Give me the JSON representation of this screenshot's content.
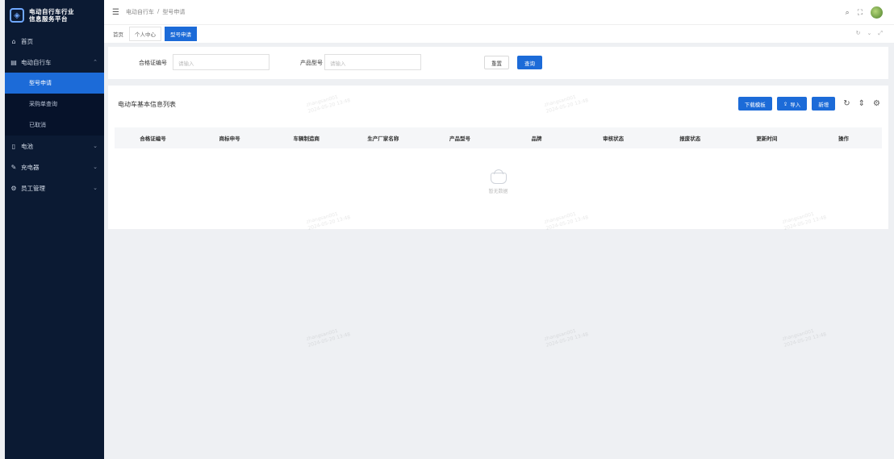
{
  "brand": {
    "title_line1": "电动自行车行业",
    "title_line2": "信息服务平台"
  },
  "sidebar": {
    "items": [
      {
        "label": "首页",
        "icon": "home-icon"
      },
      {
        "label": "电动自行车",
        "icon": "bike-icon",
        "expanded": true
      },
      {
        "label": "电池",
        "icon": "battery-icon"
      },
      {
        "label": "充电器",
        "icon": "charger-icon"
      },
      {
        "label": "员工管理",
        "icon": "staff-icon"
      }
    ],
    "submenu": [
      {
        "label": "型号申请",
        "active": true
      },
      {
        "label": "采购单查询",
        "active": false
      },
      {
        "label": "已取消",
        "active": false
      }
    ]
  },
  "header": {
    "breadcrumb": [
      "电动自行车",
      "型号申请"
    ]
  },
  "tabs": [
    {
      "label": "首页",
      "active": false
    },
    {
      "label": "个人中心",
      "active": false
    },
    {
      "label": "型号申请",
      "active": true
    }
  ],
  "search": {
    "field1_label": "合格证编号",
    "field1_placeholder": "请输入",
    "field2_label": "产品型号",
    "field2_placeholder": "请输入",
    "reset_label": "重置",
    "query_label": "查询"
  },
  "table": {
    "title": "电动车基本信息列表",
    "toolbar": {
      "download_label": "下载模板",
      "import_label": "导入",
      "add_label": "新增"
    },
    "columns": [
      "合格证编号",
      "商标申号",
      "车辆制造商",
      "生产厂家名称",
      "产品型号",
      "品牌",
      "审核状态",
      "报废状态",
      "更新时间",
      "操作"
    ],
    "empty_text": "暂无数据"
  },
  "watermark": {
    "line1": "zhangsan001",
    "line2": "2024-05-20 13:48"
  }
}
